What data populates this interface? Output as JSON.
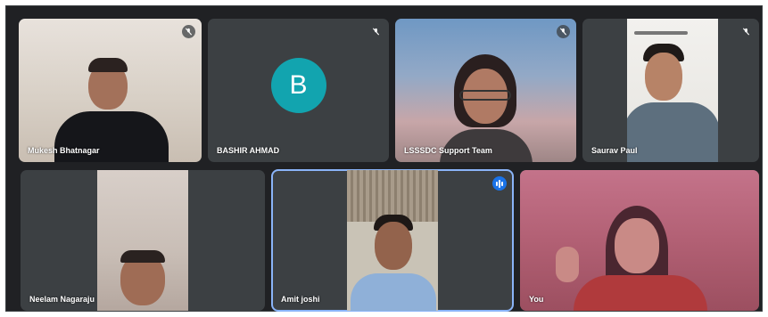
{
  "participants": [
    {
      "name": "Mukesh Bhatnagar",
      "muted": true
    },
    {
      "name": "BASHIR AHMAD",
      "muted": true,
      "initial": "B"
    },
    {
      "name": "LSSSDC Support Team",
      "muted": true
    },
    {
      "name": "Saurav Paul",
      "muted": true
    },
    {
      "name": "Neelam Nagaraju",
      "muted": false
    },
    {
      "name": "Amit joshi",
      "muted": false,
      "speaking": true
    },
    {
      "name": "You",
      "muted": false
    }
  ],
  "colors": {
    "stage_bg": "#202124",
    "tile_bg": "#3c4043",
    "avatar_teal": "#12a4af",
    "active_speaker_outline": "#8ab4f8",
    "speaking_badge": "#1a73e8"
  },
  "icons": {
    "muted": "mic-off-icon",
    "speaking": "audio-level-icon"
  }
}
